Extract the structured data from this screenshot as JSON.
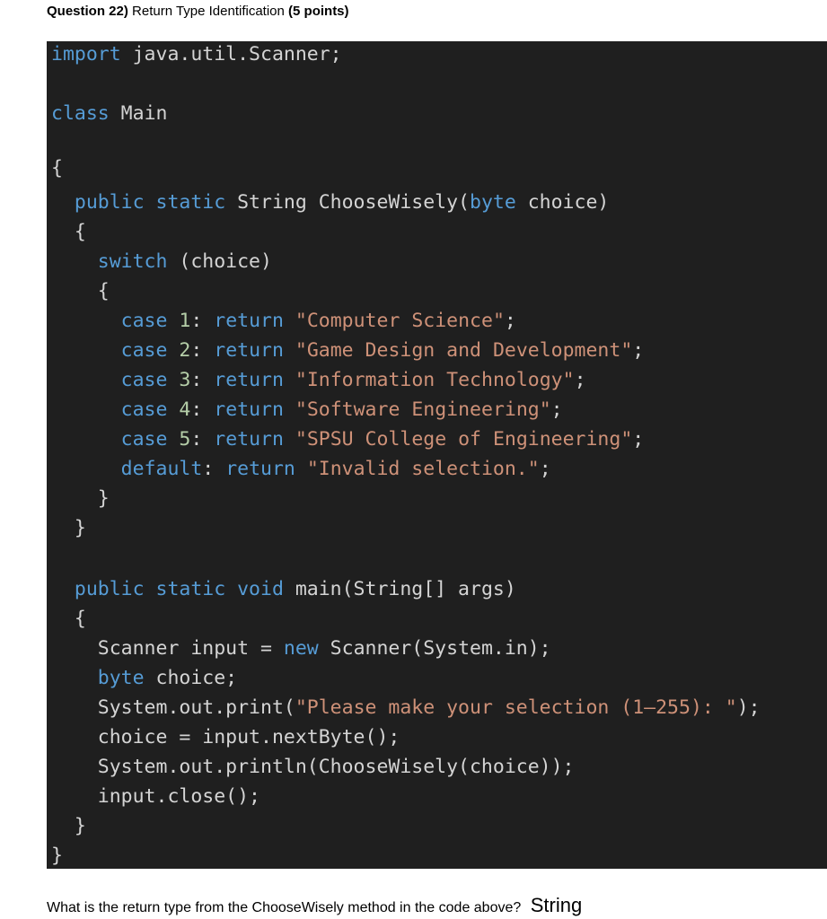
{
  "question": {
    "number_label": "Question 22)",
    "title": "Return Type Identification",
    "points": "(5 points)"
  },
  "code": {
    "l1": {
      "kw": "import",
      "rest": " java.util.Scanner;"
    },
    "l2": {
      "kw": "class",
      "rest": " Main"
    },
    "l3": "{",
    "l4": {
      "a": "public static",
      "b": " String ChooseWisely(",
      "c": "byte",
      "d": " choice)"
    },
    "l5": "{",
    "l6": {
      "kw": "switch",
      "rest": " (choice)"
    },
    "l7": "{",
    "cases": [
      {
        "kw": "case",
        "num": "1",
        "colon": ":",
        "ret": "return",
        "str": "\"Computer Science\"",
        "end": ";"
      },
      {
        "kw": "case",
        "num": "2",
        "colon": ":",
        "ret": "return",
        "str": "\"Game Design and Development\"",
        "end": ";"
      },
      {
        "kw": "case",
        "num": "3",
        "colon": ":",
        "ret": "return",
        "str": "\"Information Technology\"",
        "end": ";"
      },
      {
        "kw": "case",
        "num": "4",
        "colon": ":",
        "ret": "return",
        "str": "\"Software Engineering\"",
        "end": ";"
      },
      {
        "kw": "case",
        "num": "5",
        "colon": ":",
        "ret": "return",
        "str": "\"SPSU College of Engineering\"",
        "end": ";"
      }
    ],
    "l13": {
      "kw": "default",
      "colon": ":",
      "ret": "return",
      "str": "\"Invalid selection.\"",
      "end": ";"
    },
    "l14": "}",
    "l15": "}",
    "l17": {
      "a": "public static void",
      "b": " main(String[] args)"
    },
    "l18": "{",
    "l19": {
      "a": "Scanner input = ",
      "kw": "new",
      "b": " Scanner(System.in);"
    },
    "l20": {
      "kw": "byte",
      "rest": " choice;"
    },
    "l21": {
      "a": "System.out.print(",
      "str": "\"Please make your selection (1–255): \"",
      "b": ");"
    },
    "l22": "choice = input.nextByte();",
    "l23": "System.out.println(ChooseWisely(choice));",
    "l24": "input.close();",
    "l25": "}",
    "l26": "}"
  },
  "answer": {
    "question_text": "What is the return type from the ChooseWisely method in the code above?",
    "answer_text": "String"
  }
}
